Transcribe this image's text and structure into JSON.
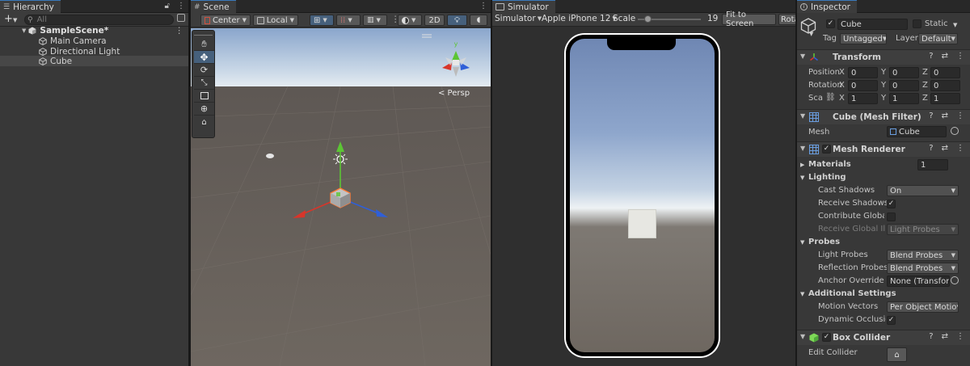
{
  "hierarchy": {
    "tab_label": "Hierarchy",
    "search_placeholder": "All",
    "add_label": "+",
    "scene_name": "SampleScene*",
    "items": [
      {
        "label": "Main Camera"
      },
      {
        "label": "Directional Light"
      },
      {
        "label": "Cube"
      }
    ]
  },
  "scene": {
    "tab_label": "Scene",
    "pivot_label": "Center",
    "space_label": "Local",
    "mode_2d": "2D",
    "persp_label": "< Persp"
  },
  "simulator": {
    "tab_label": "Simulator",
    "mode_label": "Simulator",
    "device_label": "Apple iPhone 12",
    "scale_label": "Scale",
    "scale_value": "19",
    "fit_label": "Fit to Screen",
    "rotate_label": "Rota"
  },
  "inspector": {
    "tab_label": "Inspector",
    "object_name": "Cube",
    "static_label": "Static",
    "tag_label": "Tag",
    "tag_value": "Untagged",
    "layer_label": "Layer",
    "layer_value": "Default",
    "transform": {
      "title": "Transform",
      "rows": [
        {
          "label": "Position",
          "x": "0",
          "y": "0",
          "z": "0"
        },
        {
          "label": "Rotation",
          "x": "0",
          "y": "0",
          "z": "0"
        },
        {
          "label": "Sca",
          "x": "1",
          "y": "1",
          "z": "1"
        }
      ],
      "axis_x": "X",
      "axis_y": "Y",
      "axis_z": "Z"
    },
    "mesh_filter": {
      "title": "Cube (Mesh Filter)",
      "mesh_label": "Mesh",
      "mesh_value": "Cube"
    },
    "mesh_renderer": {
      "title": "Mesh Renderer",
      "materials_label": "Materials",
      "materials_value": "1",
      "lighting_label": "Lighting",
      "cast_shadows_label": "Cast Shadows",
      "cast_shadows_value": "On",
      "receive_shadows_label": "Receive Shadows",
      "contribute_gi_label": "Contribute Global I",
      "receive_gi_label": "Receive Global Illu",
      "receive_gi_value": "Light Probes",
      "probes_label": "Probes",
      "light_probes_label": "Light Probes",
      "light_probes_value": "Blend Probes",
      "reflection_probes_label": "Reflection Probes",
      "reflection_probes_value": "Blend Probes",
      "anchor_override_label": "Anchor Override",
      "anchor_override_value": "None (Transform",
      "additional_label": "Additional Settings",
      "motion_vectors_label": "Motion Vectors",
      "motion_vectors_value": "Per Object Motio",
      "dynamic_occlusion_label": "Dynamic Occlusio"
    },
    "box_collider": {
      "title": "Box Collider",
      "edit_label": "Edit Collider"
    }
  },
  "colors": {
    "accent": "#3a79bb",
    "panel_bg": "#383838",
    "scene_ground": "#6e6760",
    "sky_top": "#6c86ad",
    "gizmo_x": "#d8352a",
    "gizmo_y": "#5cc534",
    "gizmo_z": "#2f5fd8"
  }
}
